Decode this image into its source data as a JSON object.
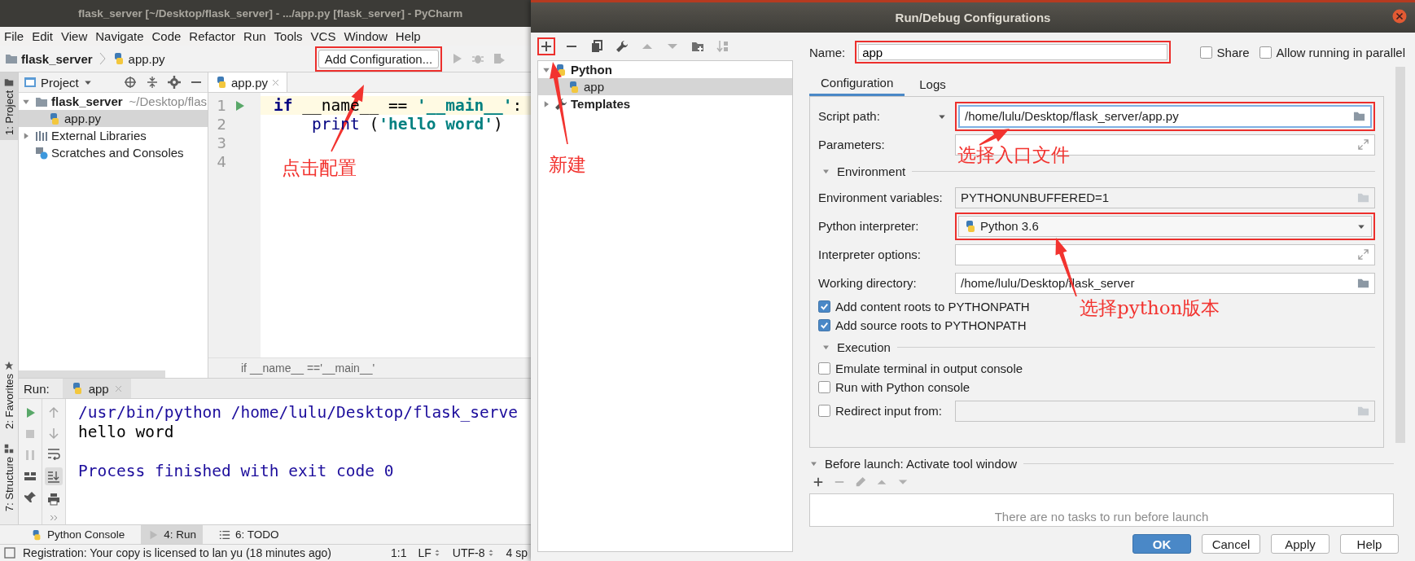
{
  "ide": {
    "title": "flask_server [~/Desktop/flask_server] - .../app.py [flask_server] - PyCharm",
    "menu": [
      "File",
      "Edit",
      "View",
      "Navigate",
      "Code",
      "Refactor",
      "Run",
      "Tools",
      "VCS",
      "Window",
      "Help"
    ],
    "breadcrumb": [
      {
        "label": "flask_server",
        "kind": "folder"
      },
      {
        "label": "app.py",
        "kind": "python"
      }
    ],
    "add_configuration": {
      "label": "Add Configuration...",
      "annotated": true
    },
    "side_tabs": [
      {
        "label": "1: Project",
        "kind": "project",
        "selected": true
      },
      {
        "label": "2: Favorites",
        "kind": "favorites",
        "selected": false
      },
      {
        "label": "7: Structure",
        "kind": "structure",
        "selected": false
      }
    ],
    "project": {
      "title": "Project",
      "tree": [
        {
          "label": "flask_server",
          "hint": "~/Desktop/flas",
          "kind": "folder",
          "expanded": true,
          "selected": false,
          "children": [
            {
              "label": "app.py",
              "kind": "python",
              "selected": true
            }
          ]
        },
        {
          "label": "External Libraries",
          "kind": "library",
          "expanded": false,
          "selected": false
        },
        {
          "label": "Scratches and Consoles",
          "kind": "scratch",
          "selected": false
        }
      ]
    },
    "editor": {
      "tab": "app.py",
      "lines": [
        {
          "number": "1",
          "runnable": true,
          "current": true,
          "tokens": [
            {
              "text": "if",
              "kind": "keyword"
            },
            {
              "text": " __name__ == ",
              "kind": "plain"
            },
            {
              "text": "'__main__'",
              "kind": "string"
            },
            {
              "text": ":",
              "kind": "plain"
            }
          ]
        },
        {
          "number": "2",
          "runnable": false,
          "current": false,
          "tokens": [
            {
              "text": "    print",
              "kind": "builtin"
            },
            {
              "text": " (",
              "kind": "plain"
            },
            {
              "text": "'hello word'",
              "kind": "string"
            },
            {
              "text": ")",
              "kind": "plain"
            }
          ]
        },
        {
          "number": "3",
          "runnable": false,
          "current": false
        },
        {
          "number": "4",
          "runnable": false,
          "current": false
        }
      ],
      "breadcrumb": "if __name__ =='__main__'"
    },
    "run": {
      "label": "Run:",
      "tab": "app",
      "console": [
        {
          "lines": [
            {
              "text": "/usr/bin/python /home/lulu/Desktop/flask_serve",
              "kind": "system"
            },
            {
              "text": "hello word",
              "kind": "output"
            }
          ]
        },
        {
          "lines": [
            {
              "text": "Process finished with exit code 0",
              "kind": "system"
            }
          ]
        }
      ]
    },
    "tool_tabs": [
      {
        "label": "Python Console",
        "kind": "python",
        "selected": false
      },
      {
        "label": "4: Run",
        "kind": "run",
        "selected": true
      },
      {
        "label": "6: TODO",
        "kind": "todo",
        "selected": false
      }
    ],
    "status": {
      "message": "Registration: Your copy is licensed to lan yu (18 minutes ago)",
      "items": [
        {
          "text": "1:1",
          "menu": false
        },
        {
          "text": "LF",
          "menu": true
        },
        {
          "text": "UTF-8",
          "menu": true
        },
        {
          "text": "4 sp",
          "menu": false
        }
      ]
    }
  },
  "dialog": {
    "title": "Run/Debug Configurations",
    "toolbar": [
      {
        "kind": "add",
        "disabled": false,
        "annotated": true
      },
      {
        "kind": "remove",
        "disabled": false,
        "annotated": false
      },
      {
        "kind": "copy",
        "disabled": false,
        "annotated": false
      },
      {
        "kind": "wrench",
        "disabled": false,
        "annotated": false
      },
      {
        "kind": "up",
        "disabled": true,
        "annotated": false
      },
      {
        "kind": "down",
        "disabled": true,
        "annotated": false
      },
      {
        "kind": "folder-add",
        "disabled": false,
        "annotated": false
      },
      {
        "kind": "sort",
        "disabled": true,
        "annotated": false
      }
    ],
    "tree": [
      {
        "label": "Python",
        "kind": "python",
        "expanded": true,
        "selected": false,
        "children": [
          {
            "label": "app",
            "kind": "python",
            "selected": true
          }
        ]
      },
      {
        "label": "Templates",
        "kind": "wrench",
        "expanded": false,
        "selected": false
      }
    ],
    "name": {
      "label": "Name:",
      "value": "app",
      "annotated": true
    },
    "options": [
      {
        "label": "Share",
        "checked": false
      },
      {
        "label": "Allow running in parallel",
        "checked": false
      }
    ],
    "tabs": [
      {
        "label": "Configuration",
        "selected": true
      },
      {
        "label": "Logs",
        "selected": false
      }
    ],
    "form": [
      {
        "kind": "field",
        "label": "Script path:",
        "value": "/home/lulu/Desktop/flask_server/app.py",
        "expandable": false,
        "label_menu": true,
        "focused": true,
        "editable": true,
        "annotated": true
      },
      {
        "kind": "field",
        "label": "Parameters:",
        "expandable": true,
        "focused": false,
        "editable": true,
        "annotated": false
      },
      {
        "kind": "section",
        "label": "Environment",
        "expanded": true
      },
      {
        "kind": "field",
        "label": "Environment variables:",
        "value": "PYTHONUNBUFFERED=1",
        "expandable": false,
        "focused": false,
        "editable": false,
        "annotated": false
      },
      {
        "kind": "select",
        "label": "Python interpreter:",
        "value": "Python 3.6",
        "annotated": true
      },
      {
        "kind": "field",
        "label": "Interpreter options:",
        "expandable": true,
        "focused": false,
        "editable": true,
        "annotated": false
      },
      {
        "kind": "field",
        "label": "Working directory:",
        "value": "/home/lulu/Desktop/flask_server",
        "expandable": false,
        "focused": false,
        "editable": true,
        "annotated": false
      },
      {
        "kind": "checkbox",
        "label": "Add content roots to PYTHONPATH",
        "checked": true
      },
      {
        "kind": "checkbox",
        "label": "Add source roots to PYTHONPATH",
        "checked": true
      },
      {
        "kind": "section",
        "label": "Execution",
        "expanded": true
      },
      {
        "kind": "checkbox",
        "label": "Emulate terminal in output console",
        "checked": false
      },
      {
        "kind": "checkbox",
        "label": "Run with Python console",
        "checked": false
      },
      {
        "kind": "checkbox_field",
        "label": "Redirect input from:",
        "checked": false,
        "expandable": false,
        "editable": false
      }
    ],
    "before_launch": {
      "title": "Before launch: Activate tool window",
      "expanded": true,
      "toolbar": [
        {
          "kind": "add",
          "disabled": false
        },
        {
          "kind": "remove",
          "disabled": true
        },
        {
          "kind": "pencil",
          "disabled": true
        },
        {
          "kind": "up",
          "disabled": true
        },
        {
          "kind": "down",
          "disabled": true
        }
      ],
      "empty": "There are no tasks to run before launch"
    },
    "buttons": [
      {
        "label": "OK",
        "default": true
      },
      {
        "label": "Cancel",
        "default": false
      },
      {
        "label": "Apply",
        "default": false
      },
      {
        "label": "Help",
        "default": false
      }
    ]
  },
  "annotations": [
    {
      "text": "点击配置"
    },
    {
      "text": "新建"
    },
    {
      "text": "选择入口文件"
    },
    {
      "text": "选择python版本"
    }
  ]
}
